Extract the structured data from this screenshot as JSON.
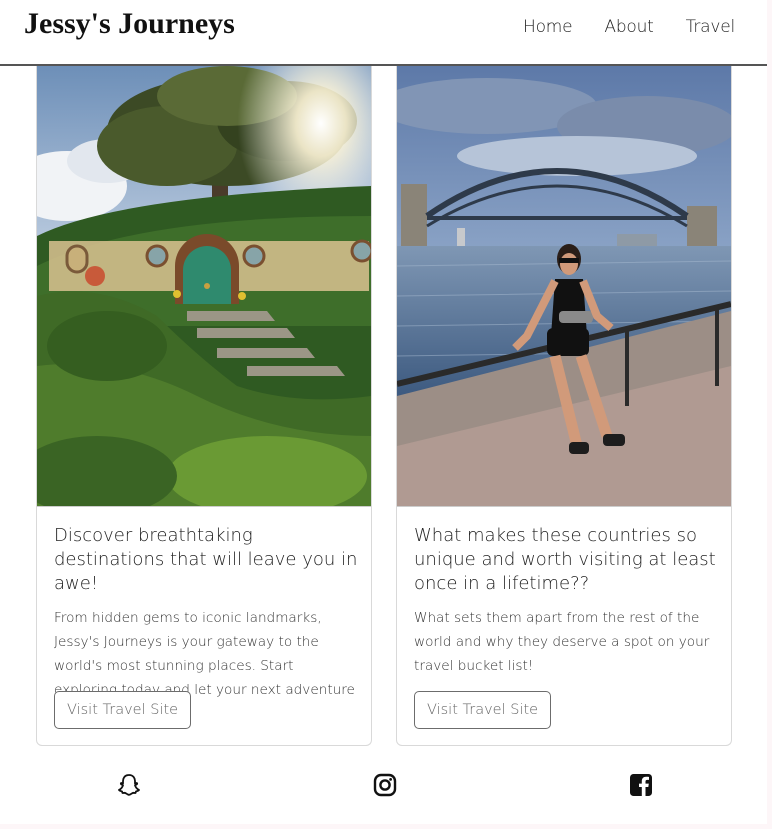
{
  "header": {
    "brand": "Jessy's Journeys",
    "nav": [
      "Home",
      "About",
      "Travel"
    ]
  },
  "cards": [
    {
      "image_alt": "hobbit-hole-photo",
      "title": "Discover breathtaking destinations that will leave you in awe!",
      "text": "From hidden gems to iconic landmarks, Jessy's Journeys is your gateway to the world's most stunning places. Start exploring today and let your next adventure begin!",
      "button": "Visit Travel Site"
    },
    {
      "image_alt": "sydney-harbour-bridge-photo",
      "title": "What makes these countries so unique and worth visiting at least once in a lifetime??",
      "text": "What sets them apart from the rest of the world and why they deserve a spot on your travel bucket list!",
      "button": "Visit Travel Site"
    }
  ],
  "footer": {
    "icons": [
      "snapchat-icon",
      "instagram-icon",
      "facebook-icon"
    ]
  }
}
